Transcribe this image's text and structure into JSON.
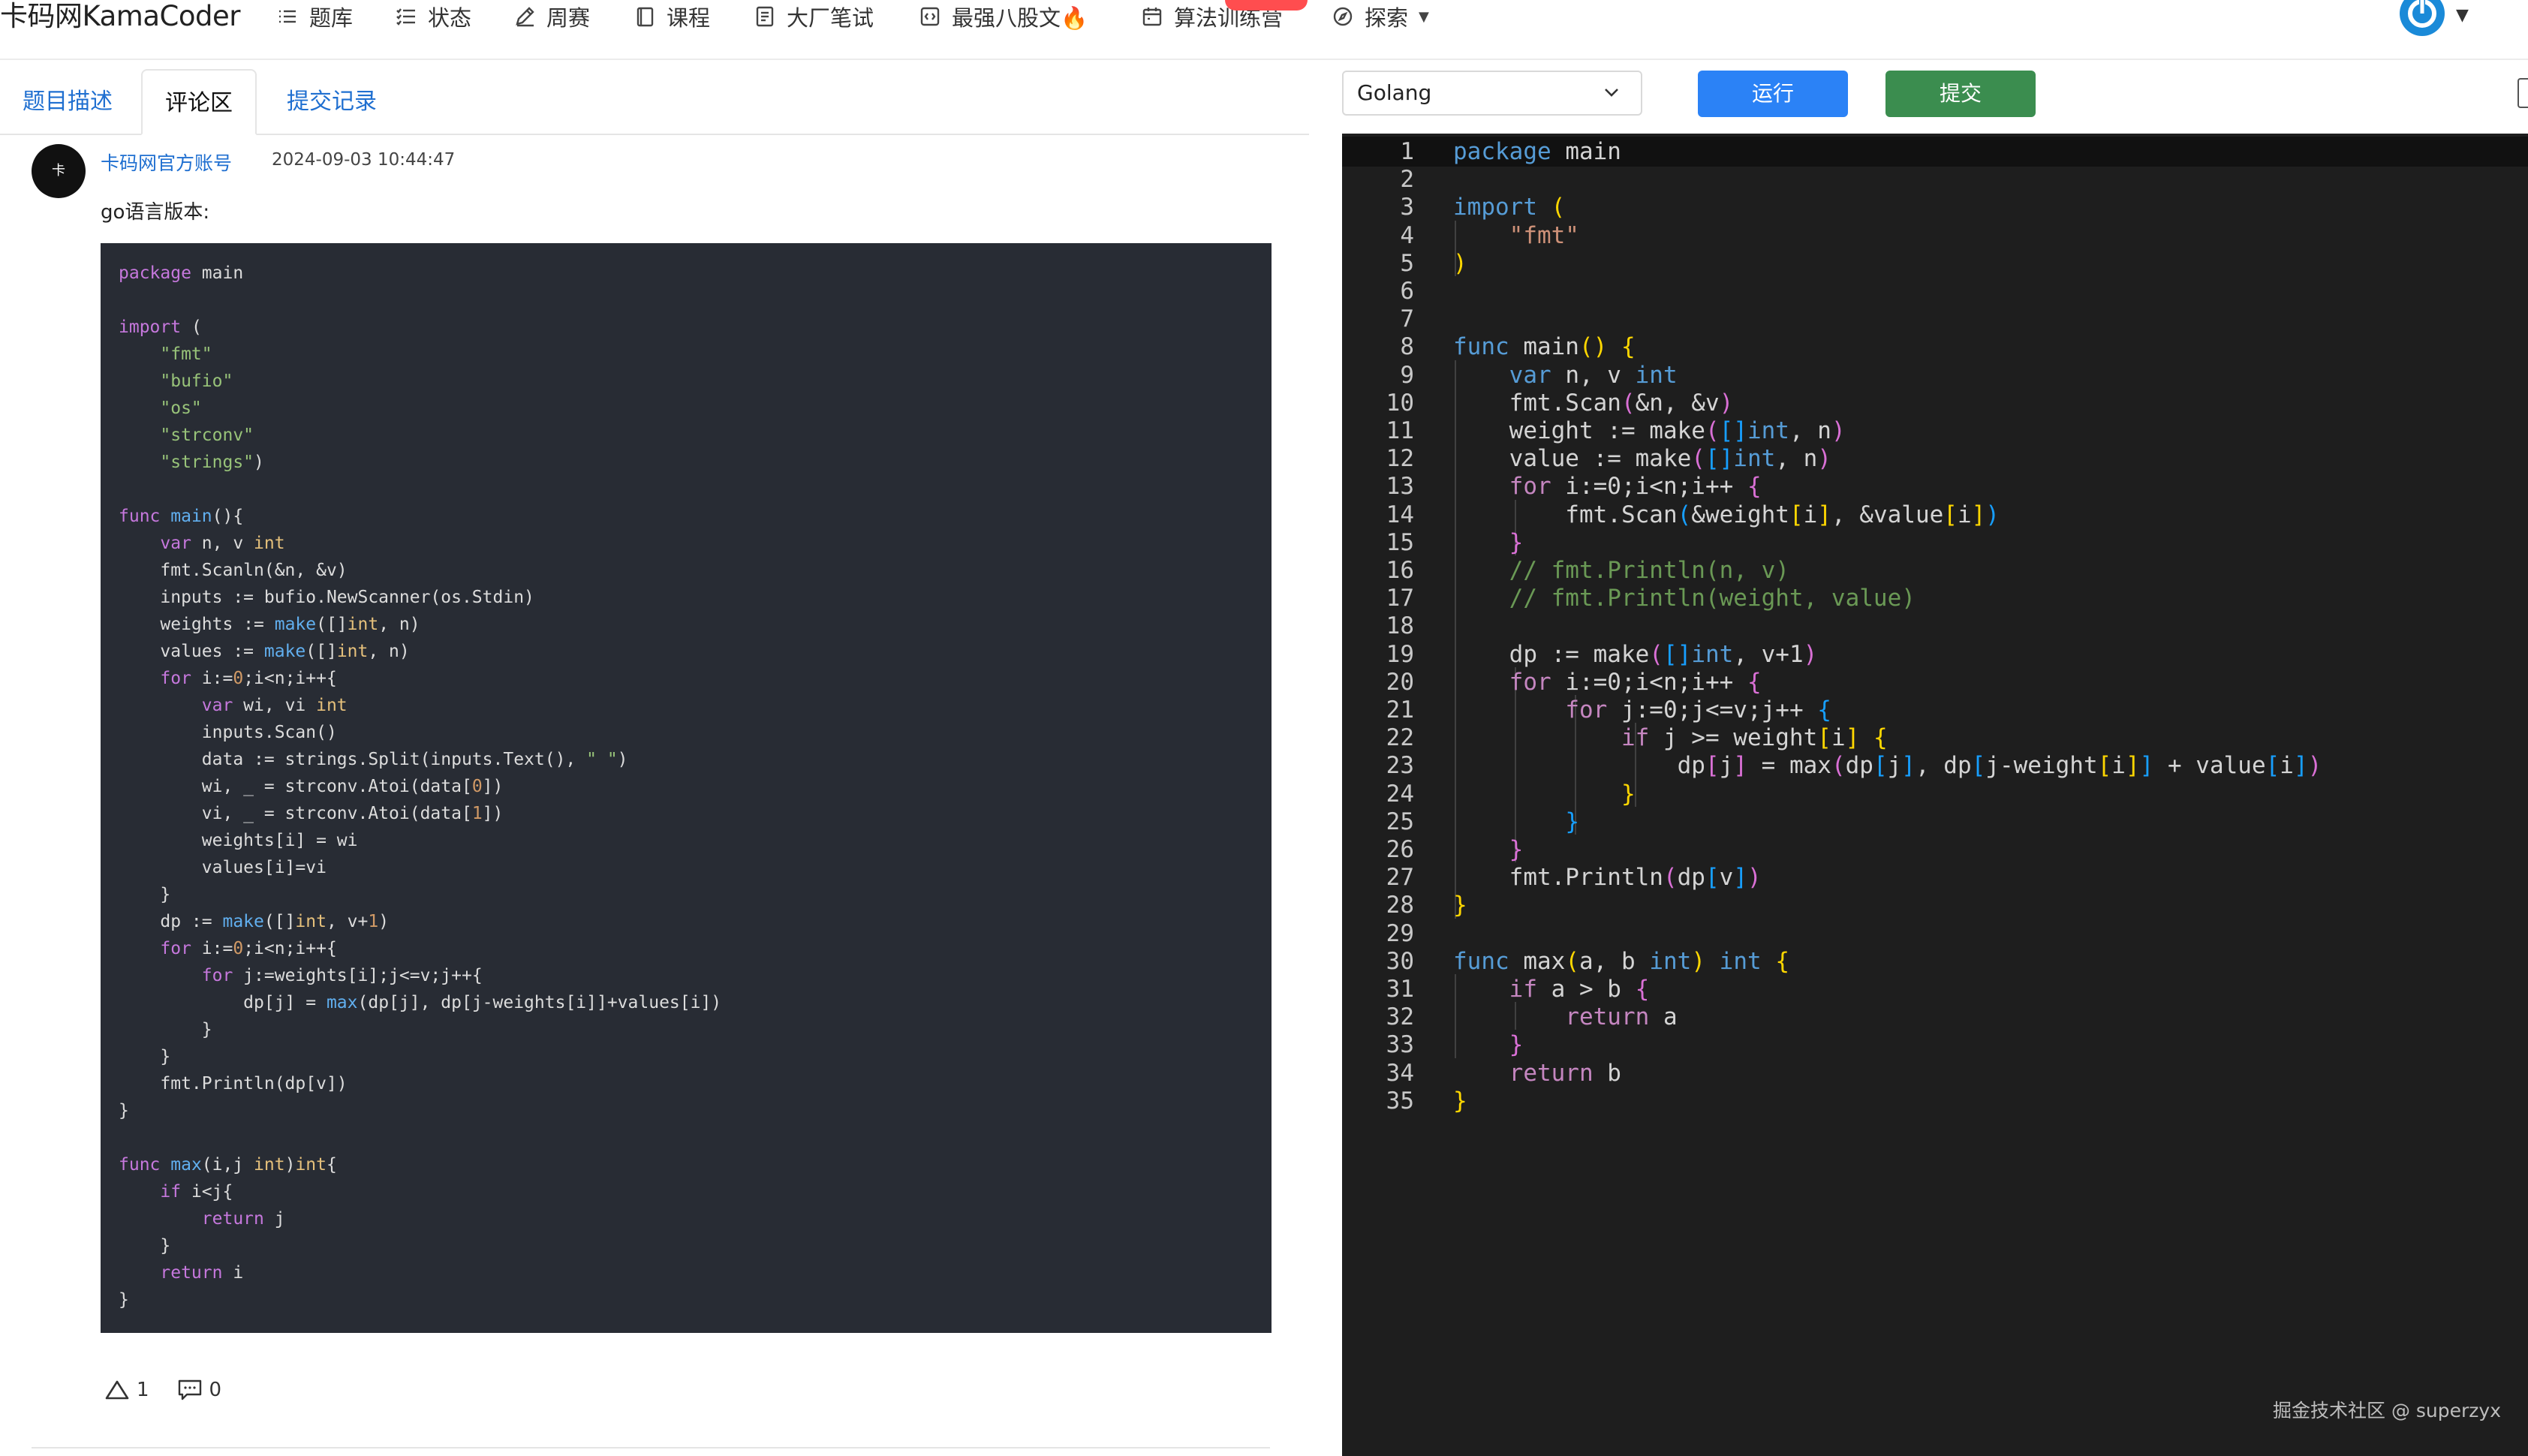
{
  "nav": {
    "logo": "卡码网KamaCoder",
    "items": [
      {
        "label": "题库",
        "icon": "list-icon"
      },
      {
        "label": "状态",
        "icon": "status-list-icon"
      },
      {
        "label": "周赛",
        "icon": "pencil-icon"
      },
      {
        "label": "课程",
        "icon": "book-icon"
      },
      {
        "label": "大厂笔试",
        "icon": "document-icon"
      },
      {
        "label": "最强八股文🔥",
        "icon": "code-icon"
      },
      {
        "label": "算法训练营",
        "icon": "calendar-icon"
      },
      {
        "label": "探索",
        "icon": "compass-icon"
      }
    ]
  },
  "tabs": [
    {
      "label": "题目描述"
    },
    {
      "label": "评论区"
    },
    {
      "label": "提交记录"
    }
  ],
  "comment": {
    "avatar_text": "卡",
    "author": "卡码网官方账号",
    "time": "2024-09-03 10:44:47",
    "intro": "go语言版本:",
    "likes": "1",
    "replies": "0",
    "code": [
      "package main",
      "",
      "import (",
      "    \"fmt\"",
      "    \"bufio\"",
      "    \"os\"",
      "    \"strconv\"",
      "    \"strings\")",
      "",
      "func main(){",
      "    var n, v int",
      "    fmt.Scanln(&n, &v)",
      "    inputs := bufio.NewScanner(os.Stdin)",
      "    weights := make([]int, n)",
      "    values := make([]int, n)",
      "    for i:=0;i<n;i++{",
      "        var wi, vi int",
      "        inputs.Scan()",
      "        data := strings.Split(inputs.Text(), \" \")",
      "        wi, _ = strconv.Atoi(data[0])",
      "        vi, _ = strconv.Atoi(data[1])",
      "        weights[i] = wi",
      "        values[i]=vi",
      "    }",
      "    dp := make([]int, v+1)",
      "    for i:=0;i<n;i++{",
      "        for j:=weights[i];j<=v;j++{",
      "            dp[j] = max(dp[j], dp[j-weights[i]]+values[i])",
      "        }",
      "    }",
      "    fmt.Println(dp[v])",
      "}",
      "",
      "func max(i,j int)int{",
      "    if i<j{",
      "        return j",
      "    }",
      "    return i",
      "}"
    ]
  },
  "editor": {
    "language": "Golang",
    "run_label": "运行",
    "submit_label": "提交",
    "lines": [
      "package main",
      "",
      "import (",
      "    \"fmt\"",
      ")",
      "",
      "",
      "func main() {",
      "    var n, v int",
      "    fmt.Scan(&n, &v)",
      "    weight := make([]int, n)",
      "    value := make([]int, n)",
      "    for i:=0;i<n;i++ {",
      "        fmt.Scan(&weight[i], &value[i])",
      "    }",
      "    // fmt.Println(n, v)",
      "    // fmt.Println(weight, value)",
      "",
      "    dp := make([]int, v+1)",
      "    for i:=0;i<n;i++ {",
      "        for j:=0;j<=v;j++ {",
      "            if j >= weight[i] {",
      "                dp[j] = max(dp[j], dp[j-weight[i]] + value[i])",
      "            }",
      "        }",
      "    }",
      "    fmt.Println(dp[v])",
      "}",
      "",
      "func max(a, b int) int {",
      "    if a > b {",
      "        return a",
      "    }",
      "    return b",
      "}"
    ]
  },
  "watermark": "掘金技术社区 @ superzyx"
}
